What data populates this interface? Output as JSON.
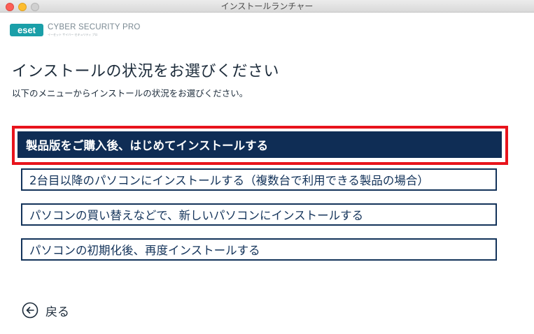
{
  "window": {
    "title": "インストールランチャー"
  },
  "brand": {
    "logo_text": "eset",
    "product_name": "CYBER SECURITY PRO",
    "product_subtitle": "イーセット サイバー セキュリティ プロ"
  },
  "page": {
    "title": "インストールの状況をお選びください",
    "subtitle": "以下のメニューからインストールの状況をお選びください。"
  },
  "options": [
    {
      "label": "製品版をご購入後、はじめてインストールする",
      "selected": true
    },
    {
      "label": "2台目以降のパソコンにインストールする（複数台で利用できる製品の場合）",
      "selected": false
    },
    {
      "label": "パソコンの買い替えなどで、新しいパソコンにインストールする",
      "selected": false
    },
    {
      "label": "パソコンの初期化後、再度インストールする",
      "selected": false
    }
  ],
  "back": {
    "label": "戻る",
    "icon": "arrow-left-circle-icon"
  },
  "colors": {
    "accent_navy": "#0f2d55",
    "highlight_red": "#e8141c",
    "logo_teal": "#1a9fa8"
  }
}
